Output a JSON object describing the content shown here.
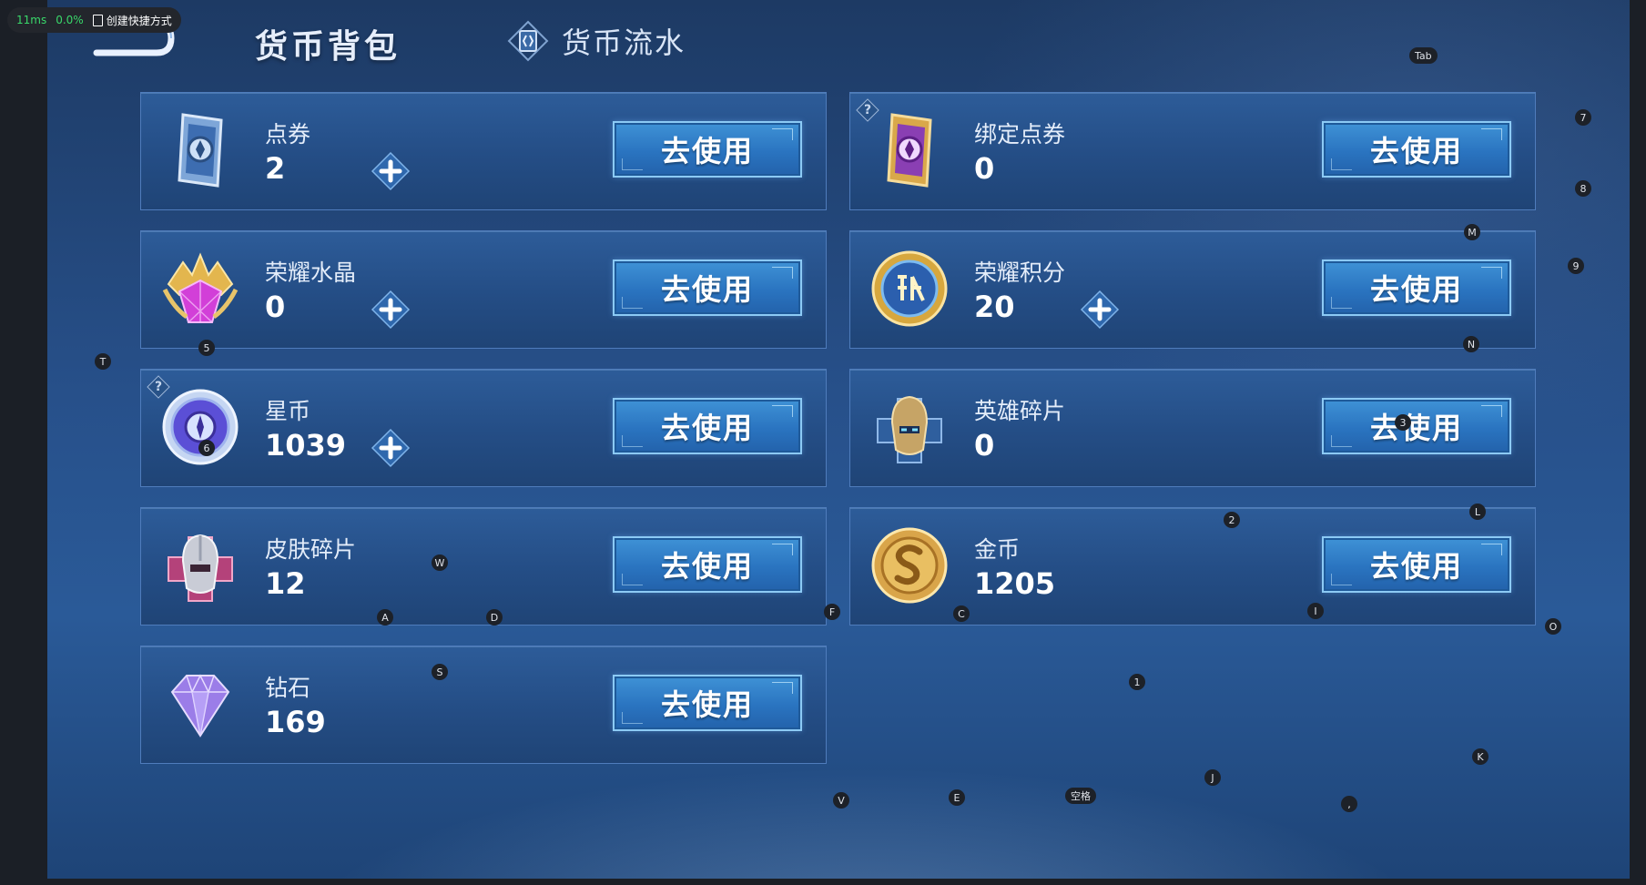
{
  "overlay": {
    "latency": "11ms",
    "percent": "0.0%",
    "shortcut_label": "创建快捷方式"
  },
  "header": {
    "title": "货币背包",
    "flow_tab": "货币流水"
  },
  "use_label": "去使用",
  "help_mark": "?",
  "cards": [
    {
      "name": "点券",
      "amount": "2",
      "icon": "coupon-icon",
      "plus": true,
      "help": false
    },
    {
      "name": "绑定点券",
      "amount": "0",
      "icon": "bound-coupon-icon",
      "plus": false,
      "help": true
    },
    {
      "name": "荣耀水晶",
      "amount": "0",
      "icon": "glory-crystal-icon",
      "plus": true,
      "help": false
    },
    {
      "name": "荣耀积分",
      "amount": "20",
      "icon": "glory-points-icon",
      "plus": true,
      "help": false
    },
    {
      "name": "星币",
      "amount": "1039",
      "icon": "star-coin-icon",
      "plus": true,
      "help": true
    },
    {
      "name": "英雄碎片",
      "amount": "0",
      "icon": "hero-fragment-icon",
      "plus": false,
      "help": false
    },
    {
      "name": "皮肤碎片",
      "amount": "12",
      "icon": "skin-fragment-icon",
      "plus": false,
      "help": false
    },
    {
      "name": "金币",
      "amount": "1205",
      "icon": "gold-coin-icon",
      "plus": false,
      "help": false
    },
    {
      "name": "钻石",
      "amount": "169",
      "icon": "diamond-icon",
      "plus": false,
      "help": false
    }
  ],
  "key_hints": [
    "Tab",
    "7",
    "8",
    "M",
    "9",
    "N",
    "T",
    "5",
    "6",
    "3",
    "2",
    "L",
    "W",
    "A",
    "D",
    "F",
    "C",
    "I",
    "O",
    "S",
    "1",
    "K",
    "J",
    "V",
    "E",
    "空格",
    ","
  ],
  "colors": {
    "card_border": "#4f7cbc",
    "button": "#2a74c0",
    "button_border": "#8ccaf5"
  }
}
